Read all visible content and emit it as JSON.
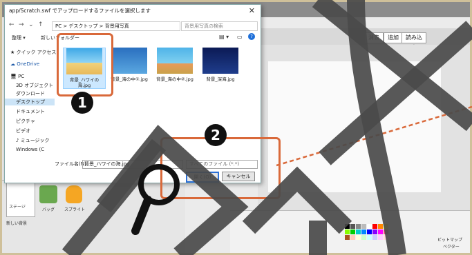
{
  "dialog": {
    "title": "app/Scratch.swf でアップロードするファイルを選択します",
    "close_glyph": "✕",
    "nav": {
      "back": "←",
      "forward": "→",
      "down": "⌄",
      "up": "↑"
    },
    "address": "PC  >  デスクトップ  >  背景用写真",
    "search_placeholder": "背景用写真の検索",
    "toolbar": {
      "organize": "整理 ▾",
      "new_folder": "新しいフォルダー"
    },
    "sidebar": [
      {
        "label": "★ クイック アクセス"
      },
      {
        "label": "☁ OneDrive"
      },
      {
        "label": "🖥 PC"
      },
      {
        "label": "3D オブジェクト"
      },
      {
        "label": "ダウンロード"
      },
      {
        "label": "デスクトップ"
      },
      {
        "label": "ドキュメント"
      },
      {
        "label": "ピクチャ"
      },
      {
        "label": "ビデオ"
      },
      {
        "label": "♪ ミュージック"
      },
      {
        "label": "Windows (C"
      }
    ],
    "files": [
      {
        "name": "背景_ハワイの海.jpg"
      },
      {
        "name": "背景_海の中①.jpg"
      },
      {
        "name": "背景_海の中②.jpg"
      },
      {
        "name": "背景_深海.jpg"
      }
    ],
    "filename_label": "ファイル名(N):",
    "filename_value": "背景_ハワイの海.jpg",
    "filter": "すべてのファイル (*.*)",
    "open_button": "開く(O)",
    "cancel_button": "キャンセル"
  },
  "scratch": {
    "toolbar": [
      "消去",
      "追加",
      "読み込み"
    ],
    "stage_label": "ステージ",
    "sprite_labels": [
      "バッグ",
      "スプライト"
    ],
    "new_bg_label": "新しい背景",
    "bitmap_label": "ビットマップ",
    "bitmap_sub": "ベクター"
  },
  "annotations": {
    "badge1": "1",
    "badge2": "2",
    "highlight_color": "#d9693a"
  }
}
